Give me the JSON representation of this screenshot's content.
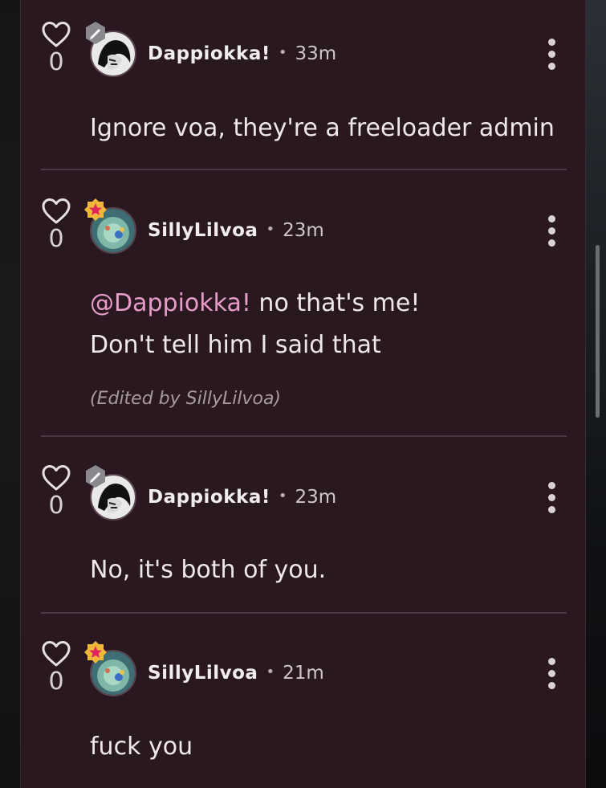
{
  "comments": [
    {
      "likes": "0",
      "username": "Dappiokka!",
      "separator": "•",
      "time": "33m",
      "badge": "pencil-icon",
      "lines": [
        "Ignore voa, they're a freeloader admin"
      ]
    },
    {
      "likes": "0",
      "username": "SillyLilvoa",
      "separator": "•",
      "time": "23m",
      "badge": "star-icon",
      "mention": "@Dappiokka!",
      "line1_rest": " no that's me!",
      "line2": "Don't tell him I said that",
      "edited": "(Edited by SillyLilvoa)"
    },
    {
      "likes": "0",
      "username": "Dappiokka!",
      "separator": "•",
      "time": "23m",
      "badge": "pencil-icon",
      "lines": [
        "No, it's both of you."
      ]
    },
    {
      "likes": "0",
      "username": "SillyLilvoa",
      "separator": "•",
      "time": "21m",
      "badge": "star-icon",
      "lines": [
        "fuck you"
      ]
    }
  ],
  "colors": {
    "panel": "#2a1820",
    "mention": "#e79cc9",
    "divider": "#4a3942"
  }
}
